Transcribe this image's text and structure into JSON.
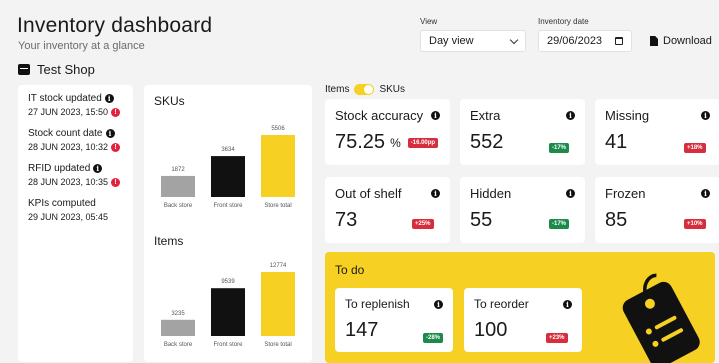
{
  "header": {
    "title": "Inventory dashboard",
    "subtitle": "Your inventory at a glance"
  },
  "shop": {
    "name": "Test Shop",
    "icon": "store-icon"
  },
  "controls": {
    "view_label": "View",
    "view_value": "Day view",
    "date_label": "Inventory date",
    "date_value": "29/06/2023",
    "download_label": "Download"
  },
  "status": [
    {
      "label": "IT stock updated",
      "value": "27 JUN 2023, 15:50",
      "alert": true
    },
    {
      "label": "Stock count date",
      "value": "28 JUN 2023, 10:32",
      "alert": true
    },
    {
      "label": "RFID updated",
      "value": "28 JUN 2023, 10:35",
      "alert": true
    },
    {
      "label": "KPIs computed",
      "value": "29 JUN 2023, 05:45",
      "alert": false
    }
  ],
  "toggle": {
    "left_label": "Items",
    "right_label": "SKUs",
    "state": "SKUs"
  },
  "metrics": [
    {
      "label": "Stock accuracy",
      "value": "75.25",
      "unit": "%",
      "badge": "-16.00pp",
      "badge_color": "red"
    },
    {
      "label": "Extra",
      "value": "552",
      "unit": "",
      "badge": "-17%",
      "badge_color": "green"
    },
    {
      "label": "Missing",
      "value": "41",
      "unit": "",
      "badge": "+18%",
      "badge_color": "red"
    },
    {
      "label": "Out of shelf",
      "value": "73",
      "unit": "",
      "badge": "+25%",
      "badge_color": "red"
    },
    {
      "label": "Hidden",
      "value": "55",
      "unit": "",
      "badge": "-17%",
      "badge_color": "green"
    },
    {
      "label": "Frozen",
      "value": "85",
      "unit": "",
      "badge": "+10%",
      "badge_color": "red"
    }
  ],
  "todo": {
    "title": "To do",
    "items": [
      {
        "label": "To replenish",
        "value": "147",
        "badge": "-28%",
        "badge_color": "green"
      },
      {
        "label": "To reorder",
        "value": "100",
        "badge": "+23%",
        "badge_color": "red"
      }
    ],
    "illustration": "clipboard-tag-icon"
  },
  "colors": {
    "accent": "#f7d024",
    "back_store": "#a3a3a3",
    "front_store": "#111111",
    "store_total": "#f7d024"
  },
  "chart_data": [
    {
      "type": "bar",
      "title": "SKUs",
      "categories": [
        "Back store",
        "Front store",
        "Store total"
      ],
      "values": [
        1872,
        3634,
        5506
      ]
    },
    {
      "type": "bar",
      "title": "Items",
      "categories": [
        "Back store",
        "Front store",
        "Store total"
      ],
      "values": [
        3235,
        9539,
        12774
      ]
    }
  ]
}
